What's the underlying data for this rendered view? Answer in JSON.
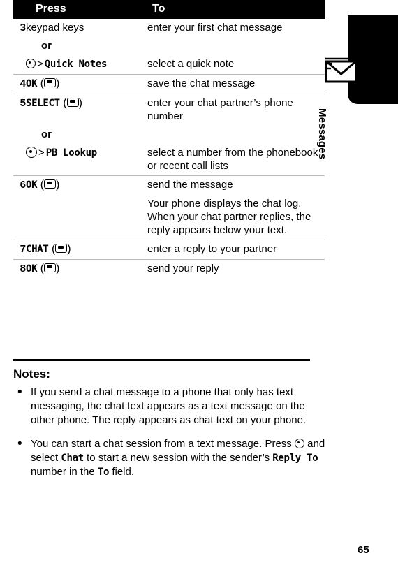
{
  "sidebar": {
    "label": "Messages",
    "icon": "envelope-icon"
  },
  "table": {
    "headers": {
      "num": "",
      "press": "Press",
      "to": "To"
    },
    "rows": [
      {
        "num": "3",
        "press_plain": "keypad keys",
        "to": "enter your first chat message"
      },
      {
        "or": "or"
      },
      {
        "press_key": "menu-key-icon",
        "press_mono": "Quick Notes",
        "to": "select a quick note"
      },
      {
        "num": "4",
        "press_mono": "OK",
        "press_soft": "softkey-icon",
        "to": "save the chat message"
      },
      {
        "num": "5",
        "press_mono": "SELECT",
        "press_soft": "softkey-icon",
        "to": "enter your chat partner’s phone number"
      },
      {
        "or": "or"
      },
      {
        "press_key": "nav-key-icon",
        "press_mono": "PB Lookup",
        "to": "select a number from the phonebook or recent call lists"
      },
      {
        "num": "6",
        "press_mono": "OK",
        "press_soft": "softkey-icon",
        "to": "send the message"
      },
      {
        "to_extra": "Your phone displays the chat log. When your chat partner replies, the reply appears below your text."
      },
      {
        "num": "7",
        "press_mono": "CHAT",
        "press_soft": "softkey-icon",
        "to": "enter a reply to your partner"
      },
      {
        "num": "8",
        "press_mono": "OK",
        "press_soft": "softkey-icon",
        "to": "send your reply"
      }
    ]
  },
  "notes": {
    "title": "Notes:",
    "items": [
      {
        "bullet": "•",
        "part1": "If you send a chat message to a phone that only has text messaging, the chat text appears as a text message on the other phone. The reply appears as chat text on your phone."
      },
      {
        "bullet": "•",
        "p1": "You can start a chat session from a text message. Press ",
        "k1": "menu-key-icon",
        "p2": " and select ",
        "m1": "Chat",
        "p3": " to start a new session with the sender’s ",
        "m2": "Reply To",
        "p4": " number in the ",
        "m3": "To",
        "p5": " field."
      }
    ]
  },
  "page_number": "65"
}
